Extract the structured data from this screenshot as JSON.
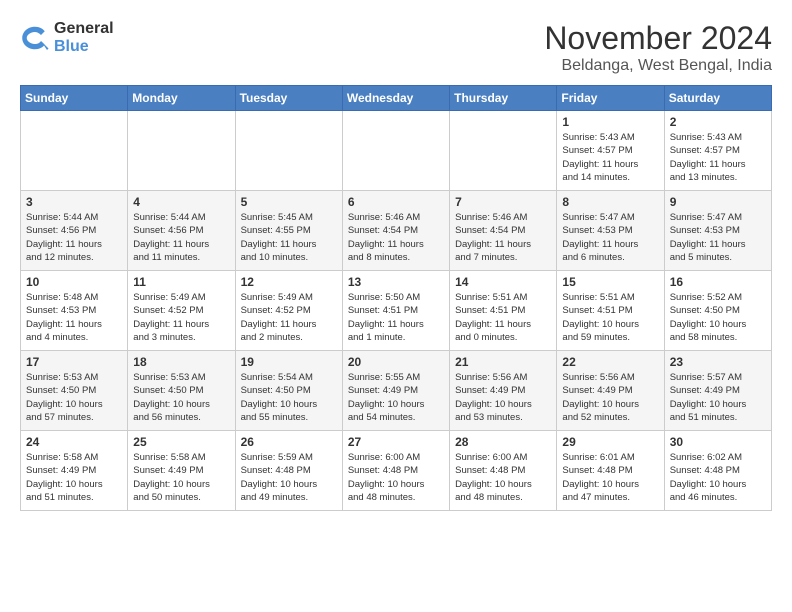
{
  "logo": {
    "general": "General",
    "blue": "Blue"
  },
  "title": "November 2024",
  "location": "Beldanga, West Bengal, India",
  "days_of_week": [
    "Sunday",
    "Monday",
    "Tuesday",
    "Wednesday",
    "Thursday",
    "Friday",
    "Saturday"
  ],
  "weeks": [
    [
      {
        "day": "",
        "info": ""
      },
      {
        "day": "",
        "info": ""
      },
      {
        "day": "",
        "info": ""
      },
      {
        "day": "",
        "info": ""
      },
      {
        "day": "",
        "info": ""
      },
      {
        "day": "1",
        "info": "Sunrise: 5:43 AM\nSunset: 4:57 PM\nDaylight: 11 hours\nand 14 minutes."
      },
      {
        "day": "2",
        "info": "Sunrise: 5:43 AM\nSunset: 4:57 PM\nDaylight: 11 hours\nand 13 minutes."
      }
    ],
    [
      {
        "day": "3",
        "info": "Sunrise: 5:44 AM\nSunset: 4:56 PM\nDaylight: 11 hours\nand 12 minutes."
      },
      {
        "day": "4",
        "info": "Sunrise: 5:44 AM\nSunset: 4:56 PM\nDaylight: 11 hours\nand 11 minutes."
      },
      {
        "day": "5",
        "info": "Sunrise: 5:45 AM\nSunset: 4:55 PM\nDaylight: 11 hours\nand 10 minutes."
      },
      {
        "day": "6",
        "info": "Sunrise: 5:46 AM\nSunset: 4:54 PM\nDaylight: 11 hours\nand 8 minutes."
      },
      {
        "day": "7",
        "info": "Sunrise: 5:46 AM\nSunset: 4:54 PM\nDaylight: 11 hours\nand 7 minutes."
      },
      {
        "day": "8",
        "info": "Sunrise: 5:47 AM\nSunset: 4:53 PM\nDaylight: 11 hours\nand 6 minutes."
      },
      {
        "day": "9",
        "info": "Sunrise: 5:47 AM\nSunset: 4:53 PM\nDaylight: 11 hours\nand 5 minutes."
      }
    ],
    [
      {
        "day": "10",
        "info": "Sunrise: 5:48 AM\nSunset: 4:53 PM\nDaylight: 11 hours\nand 4 minutes."
      },
      {
        "day": "11",
        "info": "Sunrise: 5:49 AM\nSunset: 4:52 PM\nDaylight: 11 hours\nand 3 minutes."
      },
      {
        "day": "12",
        "info": "Sunrise: 5:49 AM\nSunset: 4:52 PM\nDaylight: 11 hours\nand 2 minutes."
      },
      {
        "day": "13",
        "info": "Sunrise: 5:50 AM\nSunset: 4:51 PM\nDaylight: 11 hours\nand 1 minute."
      },
      {
        "day": "14",
        "info": "Sunrise: 5:51 AM\nSunset: 4:51 PM\nDaylight: 11 hours\nand 0 minutes."
      },
      {
        "day": "15",
        "info": "Sunrise: 5:51 AM\nSunset: 4:51 PM\nDaylight: 10 hours\nand 59 minutes."
      },
      {
        "day": "16",
        "info": "Sunrise: 5:52 AM\nSunset: 4:50 PM\nDaylight: 10 hours\nand 58 minutes."
      }
    ],
    [
      {
        "day": "17",
        "info": "Sunrise: 5:53 AM\nSunset: 4:50 PM\nDaylight: 10 hours\nand 57 minutes."
      },
      {
        "day": "18",
        "info": "Sunrise: 5:53 AM\nSunset: 4:50 PM\nDaylight: 10 hours\nand 56 minutes."
      },
      {
        "day": "19",
        "info": "Sunrise: 5:54 AM\nSunset: 4:50 PM\nDaylight: 10 hours\nand 55 minutes."
      },
      {
        "day": "20",
        "info": "Sunrise: 5:55 AM\nSunset: 4:49 PM\nDaylight: 10 hours\nand 54 minutes."
      },
      {
        "day": "21",
        "info": "Sunrise: 5:56 AM\nSunset: 4:49 PM\nDaylight: 10 hours\nand 53 minutes."
      },
      {
        "day": "22",
        "info": "Sunrise: 5:56 AM\nSunset: 4:49 PM\nDaylight: 10 hours\nand 52 minutes."
      },
      {
        "day": "23",
        "info": "Sunrise: 5:57 AM\nSunset: 4:49 PM\nDaylight: 10 hours\nand 51 minutes."
      }
    ],
    [
      {
        "day": "24",
        "info": "Sunrise: 5:58 AM\nSunset: 4:49 PM\nDaylight: 10 hours\nand 51 minutes."
      },
      {
        "day": "25",
        "info": "Sunrise: 5:58 AM\nSunset: 4:49 PM\nDaylight: 10 hours\nand 50 minutes."
      },
      {
        "day": "26",
        "info": "Sunrise: 5:59 AM\nSunset: 4:48 PM\nDaylight: 10 hours\nand 49 minutes."
      },
      {
        "day": "27",
        "info": "Sunrise: 6:00 AM\nSunset: 4:48 PM\nDaylight: 10 hours\nand 48 minutes."
      },
      {
        "day": "28",
        "info": "Sunrise: 6:00 AM\nSunset: 4:48 PM\nDaylight: 10 hours\nand 48 minutes."
      },
      {
        "day": "29",
        "info": "Sunrise: 6:01 AM\nSunset: 4:48 PM\nDaylight: 10 hours\nand 47 minutes."
      },
      {
        "day": "30",
        "info": "Sunrise: 6:02 AM\nSunset: 4:48 PM\nDaylight: 10 hours\nand 46 minutes."
      }
    ]
  ]
}
